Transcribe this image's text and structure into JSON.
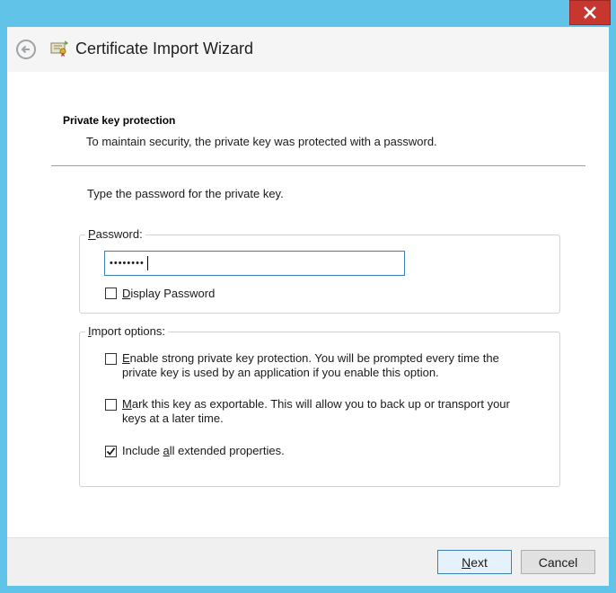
{
  "window": {
    "title": "Certificate Import Wizard",
    "close_glyph": "✕"
  },
  "icons": {
    "back": "back-arrow-icon",
    "certificate": "certificate-icon",
    "close": "close-icon",
    "checkmark": "checkmark-icon"
  },
  "header": {
    "heading": "Private key protection",
    "subheading": "To maintain security, the private key was protected with a password."
  },
  "main": {
    "instruction": "Type the password for the private key.",
    "password_group": {
      "label_prefix": "",
      "label_accel": "P",
      "label_rest": "assword:",
      "value_masked": "••••••••",
      "display_password": {
        "accel": "D",
        "rest": "isplay Password",
        "checked": false
      }
    },
    "import_options": {
      "label_prefix": "",
      "label_accel": "I",
      "label_rest": "mport options:",
      "options": [
        {
          "accel": "E",
          "rest_line1": "nable strong private key protection. You will be prompted every time the",
          "line2": "private key is used by an application if you enable this option.",
          "checked": false
        },
        {
          "accel": "M",
          "rest_line1": "ark this key as exportable. This will allow you to back up or transport your",
          "line2": "keys at a later time.",
          "checked": false
        },
        {
          "prefix": "Include ",
          "accel": "a",
          "rest": "ll extended properties.",
          "checked": true
        }
      ]
    }
  },
  "footer": {
    "next": {
      "accel": "N",
      "rest": "ext"
    },
    "cancel": "Cancel"
  },
  "colors": {
    "frame": "#62c3e9",
    "close": "#c7372f",
    "focus_border": "#3c7fb1"
  }
}
